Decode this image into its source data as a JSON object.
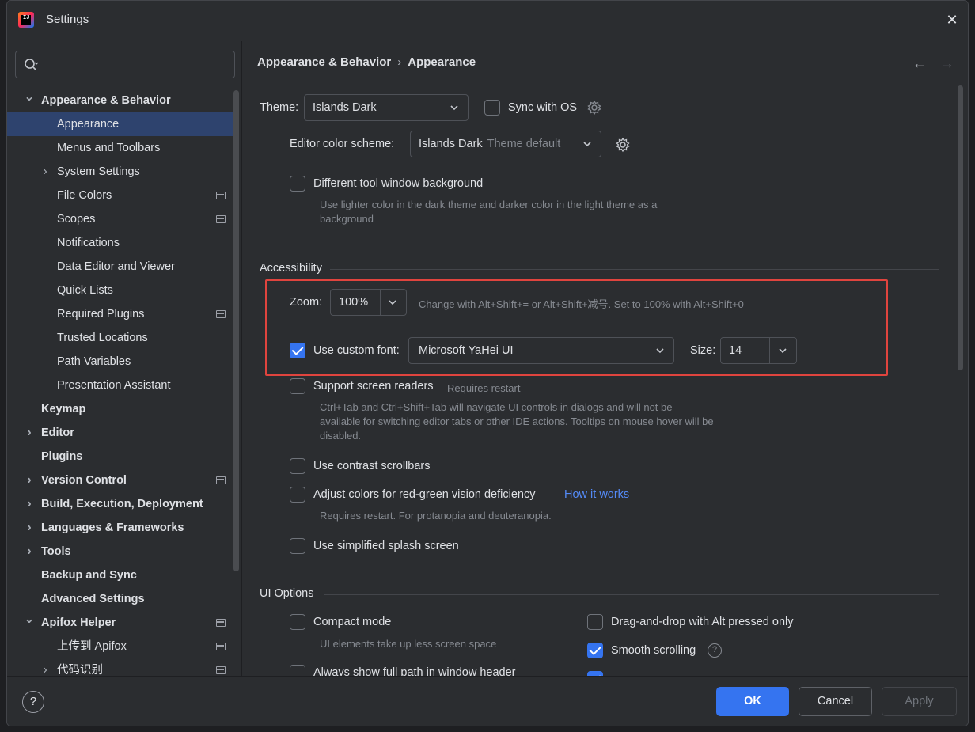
{
  "window": {
    "title": "Settings",
    "logo_text": "IJ"
  },
  "search": {
    "placeholder": "",
    "value": ""
  },
  "sidebar": {
    "items": [
      {
        "label": "Appearance & Behavior",
        "level": 0,
        "expandable": true,
        "expanded": true,
        "bold": true,
        "project": false
      },
      {
        "label": "Appearance",
        "level": 1,
        "expandable": false,
        "bold": false,
        "selected": true,
        "project": false
      },
      {
        "label": "Menus and Toolbars",
        "level": 1,
        "expandable": false,
        "bold": false,
        "project": false
      },
      {
        "label": "System Settings",
        "level": 1,
        "expandable": true,
        "expanded": false,
        "bold": false,
        "project": false
      },
      {
        "label": "File Colors",
        "level": 1,
        "expandable": false,
        "bold": false,
        "project": true
      },
      {
        "label": "Scopes",
        "level": 1,
        "expandable": false,
        "bold": false,
        "project": true
      },
      {
        "label": "Notifications",
        "level": 1,
        "expandable": false,
        "bold": false,
        "project": false
      },
      {
        "label": "Data Editor and Viewer",
        "level": 1,
        "expandable": false,
        "bold": false,
        "project": false
      },
      {
        "label": "Quick Lists",
        "level": 1,
        "expandable": false,
        "bold": false,
        "project": false
      },
      {
        "label": "Required Plugins",
        "level": 1,
        "expandable": false,
        "bold": false,
        "project": true
      },
      {
        "label": "Trusted Locations",
        "level": 1,
        "expandable": false,
        "bold": false,
        "project": false
      },
      {
        "label": "Path Variables",
        "level": 1,
        "expandable": false,
        "bold": false,
        "project": false
      },
      {
        "label": "Presentation Assistant",
        "level": 1,
        "expandable": false,
        "bold": false,
        "project": false
      },
      {
        "label": "Keymap",
        "level": 0,
        "expandable": false,
        "bold": true,
        "project": false
      },
      {
        "label": "Editor",
        "level": 0,
        "expandable": true,
        "expanded": false,
        "bold": true,
        "project": false
      },
      {
        "label": "Plugins",
        "level": 0,
        "expandable": false,
        "bold": true,
        "project": false
      },
      {
        "label": "Version Control",
        "level": 0,
        "expandable": true,
        "expanded": false,
        "bold": true,
        "project": true
      },
      {
        "label": "Build, Execution, Deployment",
        "level": 0,
        "expandable": true,
        "expanded": false,
        "bold": true,
        "project": false
      },
      {
        "label": "Languages & Frameworks",
        "level": 0,
        "expandable": true,
        "expanded": false,
        "bold": true,
        "project": false
      },
      {
        "label": "Tools",
        "level": 0,
        "expandable": true,
        "expanded": false,
        "bold": true,
        "project": false
      },
      {
        "label": "Backup and Sync",
        "level": 0,
        "expandable": false,
        "bold": true,
        "project": false
      },
      {
        "label": "Advanced Settings",
        "level": 0,
        "expandable": false,
        "bold": true,
        "project": false
      },
      {
        "label": "Apifox Helper",
        "level": 0,
        "expandable": true,
        "expanded": true,
        "bold": true,
        "project": true
      },
      {
        "label": "上传到 Apifox",
        "level": 1,
        "expandable": false,
        "bold": false,
        "project": true
      },
      {
        "label": "代码识别",
        "level": 1,
        "expandable": true,
        "expanded": false,
        "bold": false,
        "project": true
      }
    ]
  },
  "breadcrumb": {
    "parent": "Appearance & Behavior",
    "separator": "›",
    "current": "Appearance"
  },
  "appearance": {
    "theme_label": "Theme:",
    "theme_value": "Islands Dark",
    "sync_os_label": "Sync with OS",
    "sync_os_checked": false,
    "scheme_label": "Editor color scheme:",
    "scheme_value": "Islands Dark",
    "scheme_sub": "Theme default",
    "diff_bg_label": "Different tool window background",
    "diff_bg_checked": false,
    "diff_bg_hint": "Use lighter color in the dark theme and darker color in the light theme as a background"
  },
  "accessibility": {
    "section_title": "Accessibility",
    "zoom_label": "Zoom:",
    "zoom_value": "100%",
    "zoom_hint": "Change with Alt+Shift+= or Alt+Shift+减号. Set to 100% with Alt+Shift+0",
    "custom_font_label": "Use custom font:",
    "custom_font_checked": true,
    "font_value": "Microsoft YaHei UI",
    "size_label": "Size:",
    "size_value": "14",
    "screen_readers_label": "Support screen readers",
    "screen_readers_tag": "Requires restart",
    "screen_readers_checked": false,
    "screen_readers_hint": "Ctrl+Tab and Ctrl+Shift+Tab will navigate UI controls in dialogs and will not be available for switching editor tabs or other IDE actions. Tooltips on mouse hover will be disabled.",
    "contrast_label": "Use contrast scrollbars",
    "contrast_checked": false,
    "colorblind_label": "Adjust colors for red-green vision deficiency",
    "colorblind_checked": false,
    "colorblind_link": "How it works",
    "colorblind_hint": "Requires restart. For protanopia and deuteranopia.",
    "splash_label": "Use simplified splash screen",
    "splash_checked": false
  },
  "ui_options": {
    "section_title": "UI Options",
    "compact_label": "Compact mode",
    "compact_checked": false,
    "compact_hint": "UI elements take up less screen space",
    "fullpath_label": "Always show full path in window header",
    "fullpath_checked": false,
    "dnd_label": "Drag-and-drop with Alt pressed only",
    "dnd_checked": false,
    "smooth_label": "Smooth scrolling",
    "smooth_checked": true,
    "smooth_help": "?"
  },
  "footer": {
    "help": "?",
    "ok": "OK",
    "cancel": "Cancel",
    "apply": "Apply"
  },
  "colors": {
    "accent": "#3574f0",
    "highlight_box": "#e0443e",
    "selected_row": "#2e436e",
    "link": "#548af7"
  }
}
